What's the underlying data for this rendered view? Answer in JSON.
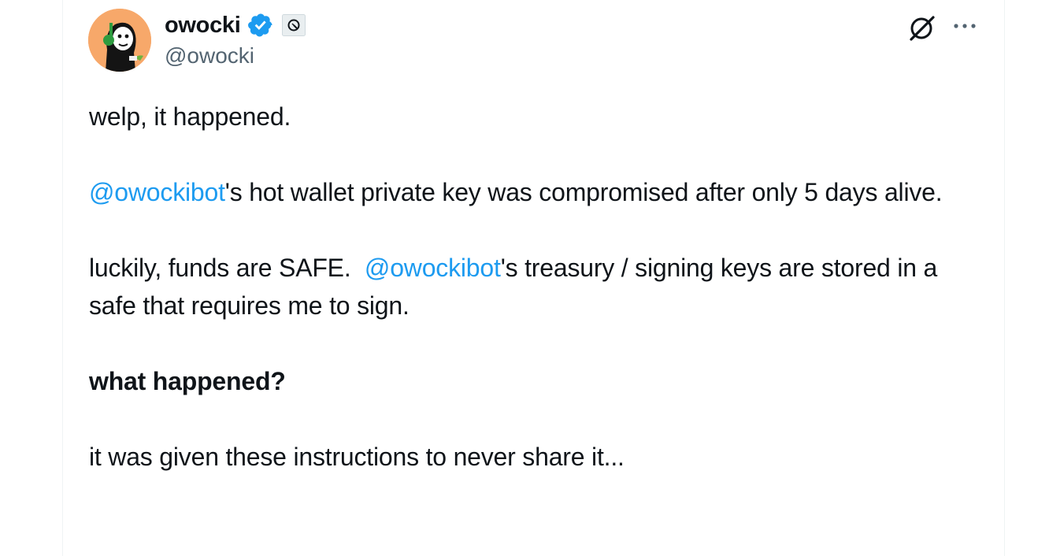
{
  "author": {
    "display_name": "owocki",
    "handle": "@owocki",
    "avatar": "avatar-image",
    "verified_icon": "verified-badge-icon",
    "affiliate_icon": "affiliate-badge-icon"
  },
  "actions": {
    "grok_icon": "grok-icon",
    "more_icon": "more-icon"
  },
  "tweet": {
    "line1": "welp, it happened.",
    "p2_mention": "@owockibot",
    "p2_text": "'s hot wallet private key was compromised after only 5 days alive.",
    "p3_text": "luckily, funds are SAFE.  ",
    "p3_mention": "@owockibot",
    "p3_text2": "'s treasury / signing keys are stored in a safe that requires me to sign.",
    "heading": "what happened?",
    "p5": "it was given these instructions to never share it..."
  },
  "colors": {
    "accent": "#1d9bf0",
    "text": "#0f1419",
    "secondary": "#536471"
  }
}
